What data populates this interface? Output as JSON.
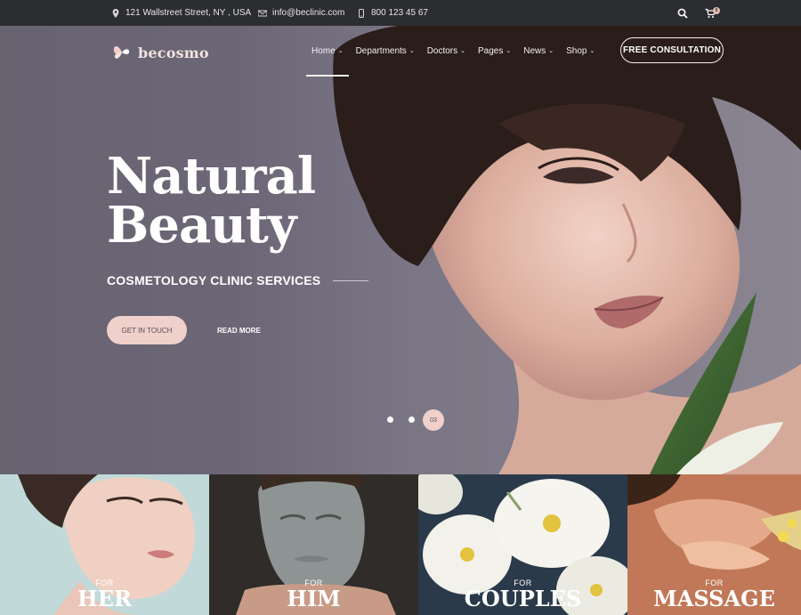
{
  "topbar": {
    "address": "121 Wallstreet Street, NY , USA",
    "email": "info@beclinic.com",
    "phone": "800 123 45 67",
    "cart_count": "0",
    "icons": [
      "location-pin-icon",
      "envelope-icon",
      "phone-icon",
      "search-icon",
      "cart-icon"
    ]
  },
  "brand": {
    "name": "becosmo",
    "accent": "#efd0cb"
  },
  "nav": {
    "items": [
      {
        "label": "Home"
      },
      {
        "label": "Departments"
      },
      {
        "label": "Doctors"
      },
      {
        "label": "Pages"
      },
      {
        "label": "News"
      },
      {
        "label": "Shop"
      }
    ],
    "active": "Home",
    "cta": "FREE CONSULTATION"
  },
  "hero": {
    "title_line1": "Natural",
    "title_line2": "Beauty",
    "subtitle": "COSMETOLOGY CLINIC SERVICES",
    "primary_button": "GET IN TOUCH",
    "secondary_button": "READ MORE",
    "slider": {
      "current": "03",
      "total_slides": 3
    }
  },
  "categories": [
    {
      "for": "FOR",
      "name": "HER"
    },
    {
      "for": "FOR",
      "name": "HIM"
    },
    {
      "for": "FOR",
      "name": "COUPLES"
    },
    {
      "for": "FOR",
      "name": "MASSAGE"
    }
  ],
  "colors": {
    "topbar_bg": "#2c2d31",
    "hero_bg": "#6e6878",
    "button_pink": "#efd0cb"
  }
}
